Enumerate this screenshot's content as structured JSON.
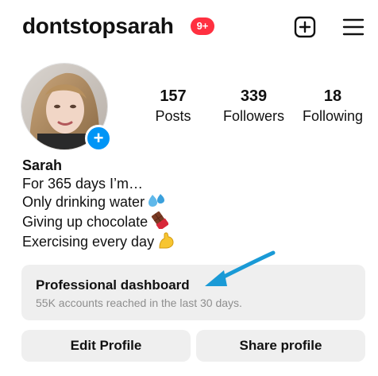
{
  "header": {
    "username": "dontstopsarah",
    "notification_badge": "9+",
    "new_post_icon": "plus-square-icon",
    "menu_icon": "hamburger-menu-icon"
  },
  "avatar": {
    "add_icon": "plus-circle-icon",
    "add_symbol": "+"
  },
  "stats": {
    "posts": {
      "count": "157",
      "label": "Posts"
    },
    "followers": {
      "count": "339",
      "label": "Followers"
    },
    "following": {
      "count": "18",
      "label": "Following"
    }
  },
  "bio": {
    "name": "Sarah",
    "lines": [
      "For 365 days I’m…",
      "Only drinking water",
      "Giving up chocolate",
      "Exercising every day"
    ],
    "emoji_icons": [
      "sweat-droplets-icon",
      "chocolate-bar-icon",
      "flexed-biceps-icon"
    ]
  },
  "dashboard": {
    "title": "Professional dashboard",
    "subtitle": "55K accounts reached in the last 30 days."
  },
  "buttons": {
    "edit_profile": "Edit Profile",
    "share_profile": "Share profile"
  },
  "colors": {
    "badge_red": "#ff3040",
    "accent_blue": "#0095f6",
    "arrow_blue": "#1a9ad6",
    "button_gray": "#efefef",
    "muted_text": "#8e8e8e"
  }
}
